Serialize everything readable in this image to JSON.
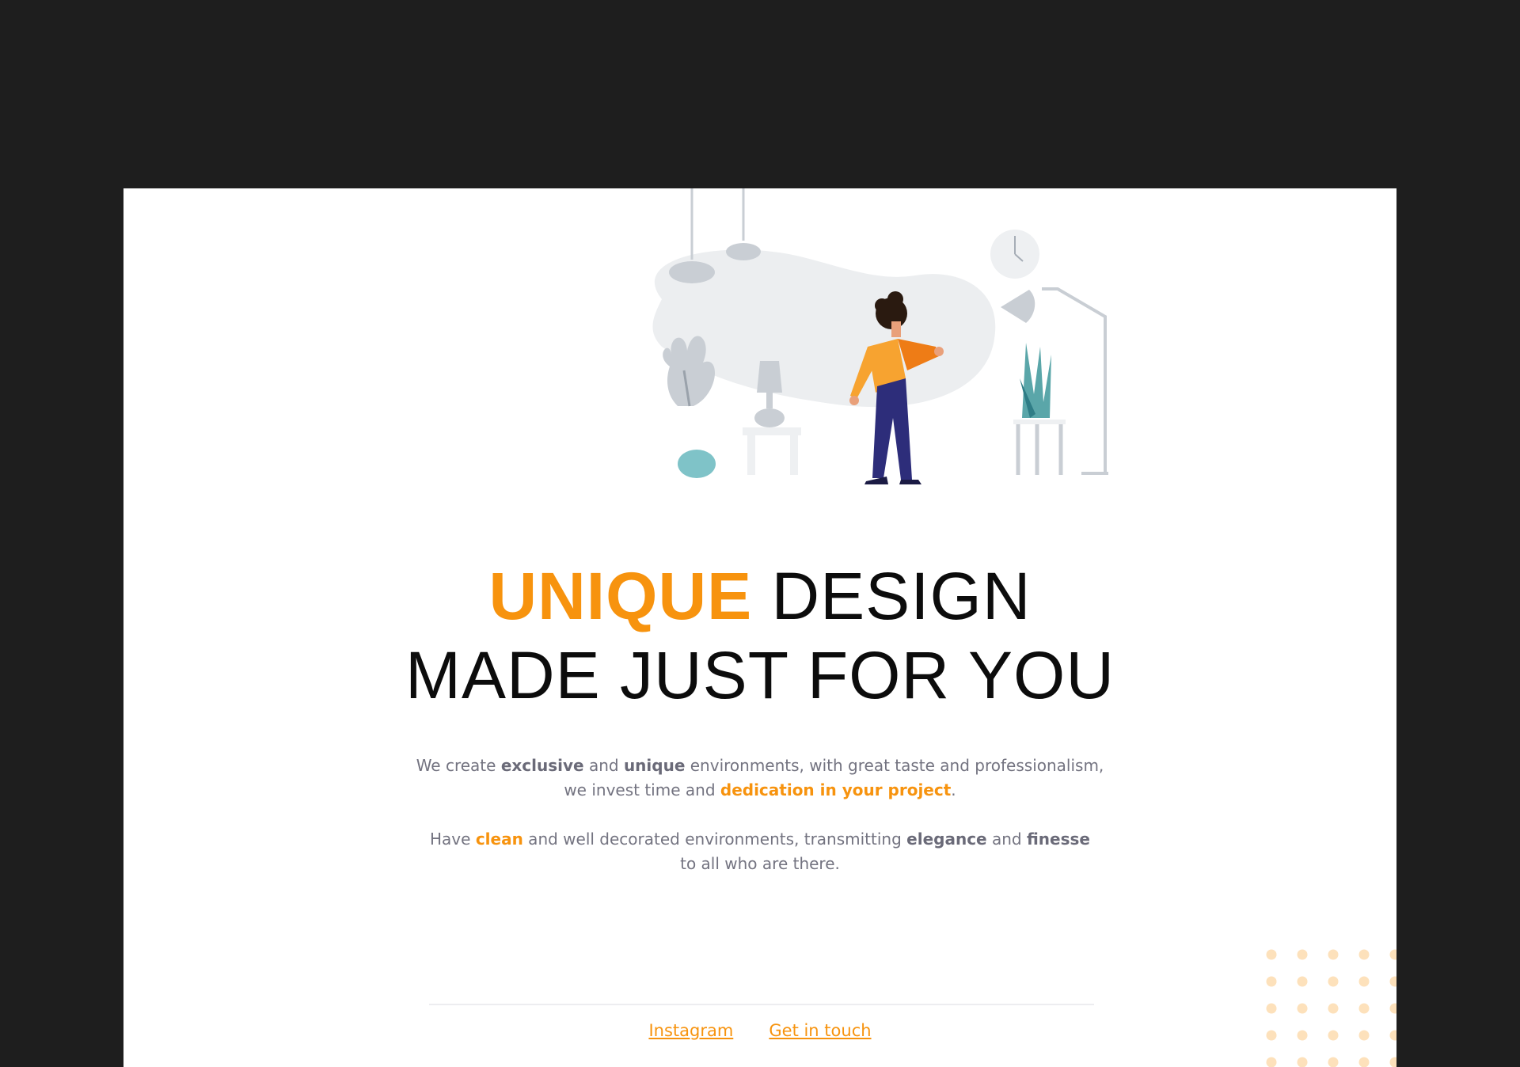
{
  "hero": {
    "headline_accent": "UNIQUE",
    "headline_rest": " DESIGN",
    "headline_line2": "MADE JUST FOR YOU"
  },
  "intro": {
    "p1": [
      "We create ",
      "exclusive",
      " and ",
      "unique",
      " environments, with great taste and professionalism,"
    ],
    "p1_line2": [
      "we invest time and ",
      "dedication in your project",
      "."
    ],
    "p2": [
      "Have ",
      "clean",
      " and well decorated environments, transmitting ",
      "elegance",
      " and ",
      "finesse"
    ],
    "p2_line2": "to all who are there."
  },
  "footer": {
    "links": [
      "Instagram",
      "Get in touch"
    ]
  },
  "colors": {
    "background": "#1e1e1e",
    "page": "#ffffff",
    "accent": "#f7930e",
    "body_text": "#737380",
    "dots": "#fde1bb"
  },
  "icons": [
    "person-illustration",
    "clock-icon",
    "floor-lamp-icon",
    "table-lamp-icon",
    "pendant-lamp-icon",
    "plant-icon"
  ]
}
